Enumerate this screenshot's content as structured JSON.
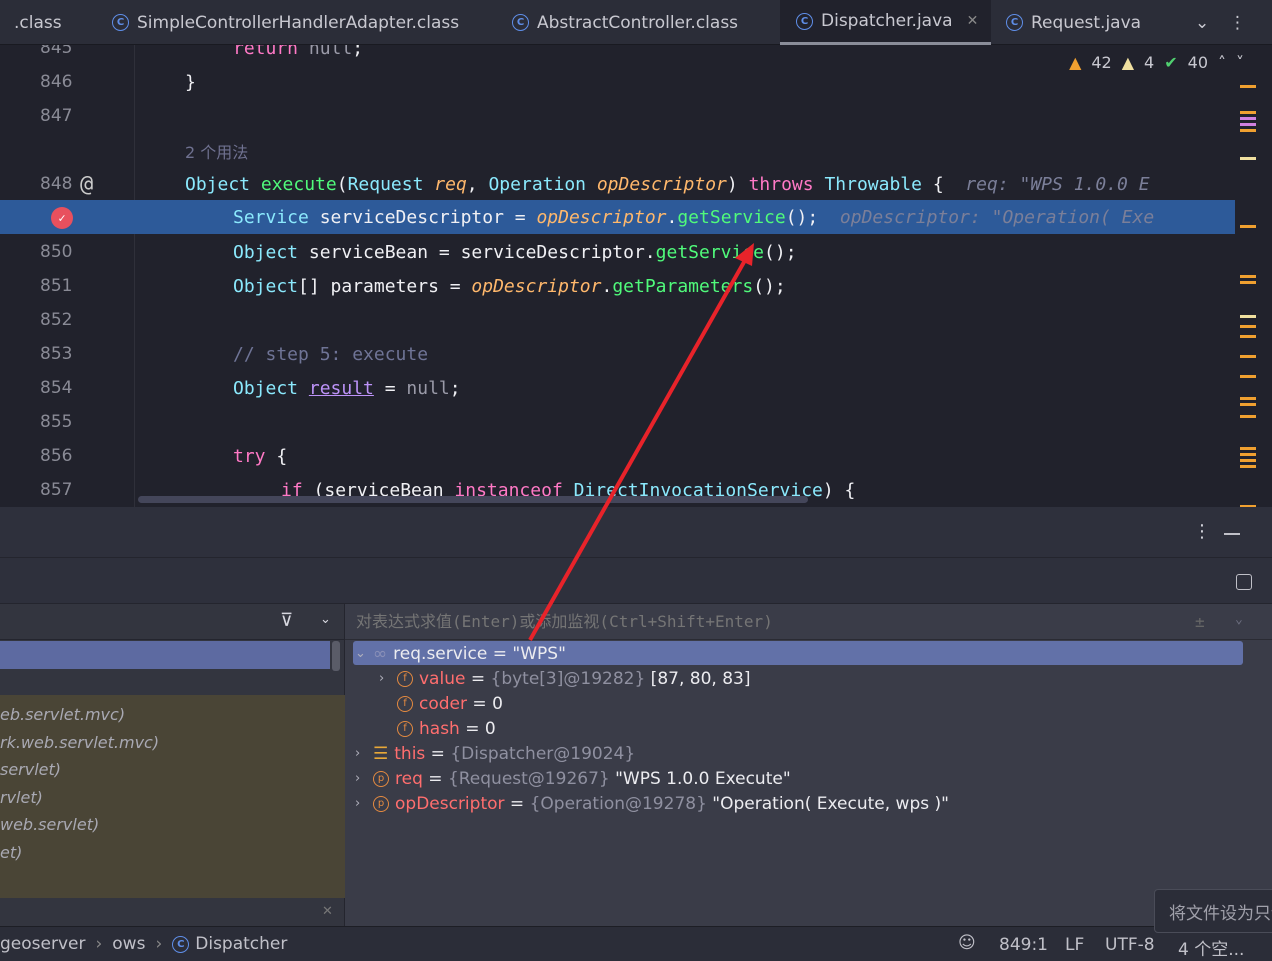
{
  "tabs": [
    {
      "label": ".class"
    },
    {
      "label": "SimpleControllerHandlerAdapter.class"
    },
    {
      "label": "AbstractController.class"
    },
    {
      "label": "Dispatcher.java",
      "active": true
    },
    {
      "label": "Request.java"
    }
  ],
  "inspections": {
    "warnings": "42",
    "weak_warnings": "4",
    "typos": "40"
  },
  "editor": {
    "usage_hint": "2 个用法",
    "lines": [
      {
        "n": "845",
        "tokens": [
          [
            "kw",
            "return "
          ],
          [
            "nu",
            "null"
          ],
          [
            "pl",
            ";"
          ]
        ],
        "indent": 1
      },
      {
        "n": "846",
        "tokens": [
          [
            "pl",
            "}"
          ]
        ],
        "indent": 0
      },
      {
        "n": "847",
        "tokens": [],
        "indent": 0
      },
      {
        "n": "848",
        "tokens": [
          [
            "ty",
            "Object "
          ],
          [
            "fn",
            "execute"
          ],
          [
            "pl",
            "("
          ],
          [
            "ty",
            "Request "
          ],
          [
            "pa",
            "req"
          ],
          [
            "pl",
            ", "
          ],
          [
            "ty",
            "Operation "
          ],
          [
            "pa",
            "opDescriptor"
          ],
          [
            "pl",
            ") "
          ],
          [
            "kw",
            "throws "
          ],
          [
            "ty",
            "Throwable "
          ],
          [
            "pl",
            "{  "
          ],
          [
            "hint",
            "req: \"WPS 1.0.0 E"
          ]
        ],
        "indent": 0
      },
      {
        "n": "849",
        "tokens": [
          [
            "ty",
            "Service "
          ],
          [
            "pl",
            "serviceDescriptor = "
          ],
          [
            "pa",
            "opDescriptor"
          ],
          [
            "pl",
            "."
          ],
          [
            "fn",
            "getService"
          ],
          [
            "pl",
            "();  "
          ],
          [
            "hint",
            "opDescriptor: \"Operation( Exe"
          ]
        ],
        "indent": 1
      },
      {
        "n": "850",
        "tokens": [
          [
            "ty",
            "Object "
          ],
          [
            "pl",
            "serviceBean = serviceDescriptor."
          ],
          [
            "fn",
            "getService"
          ],
          [
            "pl",
            "();"
          ]
        ],
        "indent": 1
      },
      {
        "n": "851",
        "tokens": [
          [
            "ty",
            "Object"
          ],
          [
            "pl",
            "[] parameters = "
          ],
          [
            "pa",
            "opDescriptor"
          ],
          [
            "pl",
            "."
          ],
          [
            "fn",
            "getParameters"
          ],
          [
            "pl",
            "();"
          ]
        ],
        "indent": 1
      },
      {
        "n": "852",
        "tokens": [],
        "indent": 1
      },
      {
        "n": "853",
        "tokens": [
          [
            "cm",
            "// step 5: execute"
          ]
        ],
        "indent": 1
      },
      {
        "n": "854",
        "tokens": [
          [
            "ty",
            "Object "
          ],
          [
            "ul",
            "result"
          ],
          [
            "pl",
            " = "
          ],
          [
            "nu",
            "null"
          ],
          [
            "pl",
            ";"
          ]
        ],
        "indent": 1
      },
      {
        "n": "855",
        "tokens": [],
        "indent": 1
      },
      {
        "n": "856",
        "tokens": [
          [
            "kw",
            "try "
          ],
          [
            "pl",
            "{"
          ]
        ],
        "indent": 1
      },
      {
        "n": "857",
        "tokens": [
          [
            "kw",
            "if "
          ],
          [
            "pl",
            "(serviceBean "
          ],
          [
            "kw",
            "instanceof "
          ],
          [
            "ty",
            "DirectInvocationService"
          ],
          [
            "pl",
            ") {"
          ]
        ],
        "indent": 2
      }
    ]
  },
  "frames": [
    "eb.servlet.mvc)",
    "rk.web.servlet.mvc)",
    "servlet)",
    "rvlet)",
    "web.servlet)",
    "et)"
  ],
  "evaluate_placeholder": "对表达式求值(Enter)或添加监视(Ctrl+Shift+Enter)",
  "variables": [
    {
      "expander": "v",
      "icon": "watch",
      "name": "req.service",
      "eq": " = ",
      "type": "",
      "value": "\"WPS\"",
      "depth": 0,
      "selected": true
    },
    {
      "expander": ">",
      "icon": "f",
      "name": "value",
      "eq": " = ",
      "type": "{byte[3]@19282}",
      "value": " [87, 80, 83]",
      "depth": 1
    },
    {
      "expander": "",
      "icon": "f",
      "name": "coder",
      "eq": " = ",
      "type": "",
      "value": "0",
      "depth": 1
    },
    {
      "expander": "",
      "icon": "f",
      "name": "hash",
      "eq": " = ",
      "type": "",
      "value": "0",
      "depth": 1
    },
    {
      "expander": ">",
      "icon": "this",
      "name": "this",
      "eq": " = ",
      "type": "{Dispatcher@19024}",
      "value": "",
      "depth": 0
    },
    {
      "expander": ">",
      "icon": "p",
      "name": "req",
      "eq": " = ",
      "type": "{Request@19267}",
      "value": " \"WPS 1.0.0 Execute\"",
      "depth": 0
    },
    {
      "expander": ">",
      "icon": "p",
      "name": "opDescriptor",
      "eq": " = ",
      "type": "{Operation@19278}",
      "value": " \"Operation( Execute, wps )\"",
      "depth": 0
    }
  ],
  "status": {
    "breadcrumb": [
      "geoserver",
      "ows",
      "Dispatcher"
    ],
    "position": "849:1",
    "line_sep": "LF",
    "encoding": "UTF-8",
    "indent": "4 个空..."
  },
  "popup": "将文件设为只读",
  "colors": {
    "accent": "#2d5a99",
    "arrow": "#e8232a",
    "breakpoint": "#e8505e"
  }
}
